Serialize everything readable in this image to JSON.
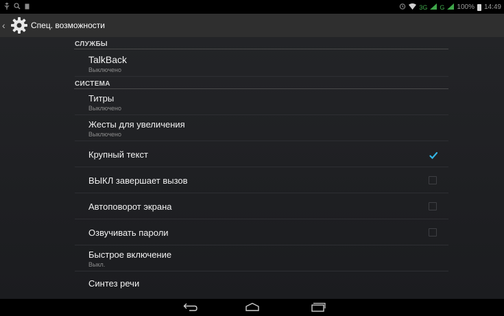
{
  "status_bar": {
    "left_icons": [
      "usb-icon",
      "search-icon",
      "notification-icon"
    ],
    "network_label": "3G",
    "battery_percent": "100%",
    "time": "14:49"
  },
  "action_bar": {
    "title": "Спец. возможности",
    "icon": "gear-icon"
  },
  "sections": {
    "services": {
      "header": "СЛУЖБЫ",
      "items": [
        {
          "title": "TalkBack",
          "summary": "Выключено"
        }
      ]
    },
    "system": {
      "header": "СИСТЕМА",
      "items": [
        {
          "title": "Титры",
          "summary": "Выключено"
        },
        {
          "title": "Жесты для увеличения",
          "summary": "Выключено"
        },
        {
          "title": "Крупный текст",
          "checked": true
        },
        {
          "title": "ВЫКЛ завершает вызов",
          "checked": false
        },
        {
          "title": "Автоповорот экрана",
          "checked": false
        },
        {
          "title": "Озвучивать пароли",
          "checked": false
        },
        {
          "title": "Быстрое включение",
          "summary": "Выкл."
        },
        {
          "title": "Синтез речи"
        }
      ]
    }
  },
  "nav_bar": {
    "buttons": [
      "back-icon",
      "home-icon",
      "recents-icon"
    ]
  },
  "colors": {
    "accent": "#33b5e5",
    "action_bar_bg": "#2f2f2f",
    "content_bg": "#1f2023"
  }
}
